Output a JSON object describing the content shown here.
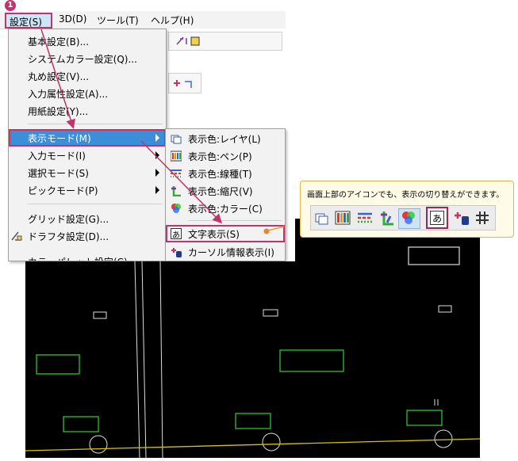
{
  "menubar": {
    "items": [
      {
        "label": "設定(S)"
      },
      {
        "label": "3D(D)"
      },
      {
        "label": "ツール(T)"
      },
      {
        "label": "ヘルプ(H)"
      }
    ]
  },
  "step_badge": "1",
  "menu": {
    "items": [
      {
        "label": "基本設定(B)..."
      },
      {
        "label": "システムカラー設定(Q)..."
      },
      {
        "label": "丸め設定(V)..."
      },
      {
        "label": "入力属性設定(A)..."
      },
      {
        "label": "用紙設定(Y)..."
      },
      {
        "label": "表示モード(M)"
      },
      {
        "label": "入力モード(I)"
      },
      {
        "label": "選択モード(S)"
      },
      {
        "label": "ピックモード(P)"
      },
      {
        "label": "グリッド設定(G)..."
      },
      {
        "label": "ドラフタ設定(D)..."
      },
      {
        "label": "カラーパレット設定(C)..."
      }
    ]
  },
  "submenu": {
    "items": [
      {
        "label": "表示色:レイヤ(L)",
        "icon": "layer-color-icon"
      },
      {
        "label": "表示色:ペン(P)",
        "icon": "pen-color-icon"
      },
      {
        "label": "表示色:線種(T)",
        "icon": "linetype-color-icon"
      },
      {
        "label": "表示色:縮尺(V)",
        "icon": "scale-color-icon"
      },
      {
        "label": "表示色:カラー(C)",
        "icon": "color-icon"
      },
      {
        "label": "文字表示(S)",
        "icon": "text-display-icon"
      },
      {
        "label": "カーソル情報表示(I)",
        "icon": "cursor-info-icon"
      }
    ]
  },
  "callout": {
    "text": "画面上部のアイコンでも、表示の切り替えができます。",
    "glyph_text": "あ"
  },
  "colors": {
    "highlight": "#c0336b",
    "menu_selected": "#3b8fd9",
    "cad_green": "#2fd12f",
    "cad_yellow": "#d6c400"
  }
}
